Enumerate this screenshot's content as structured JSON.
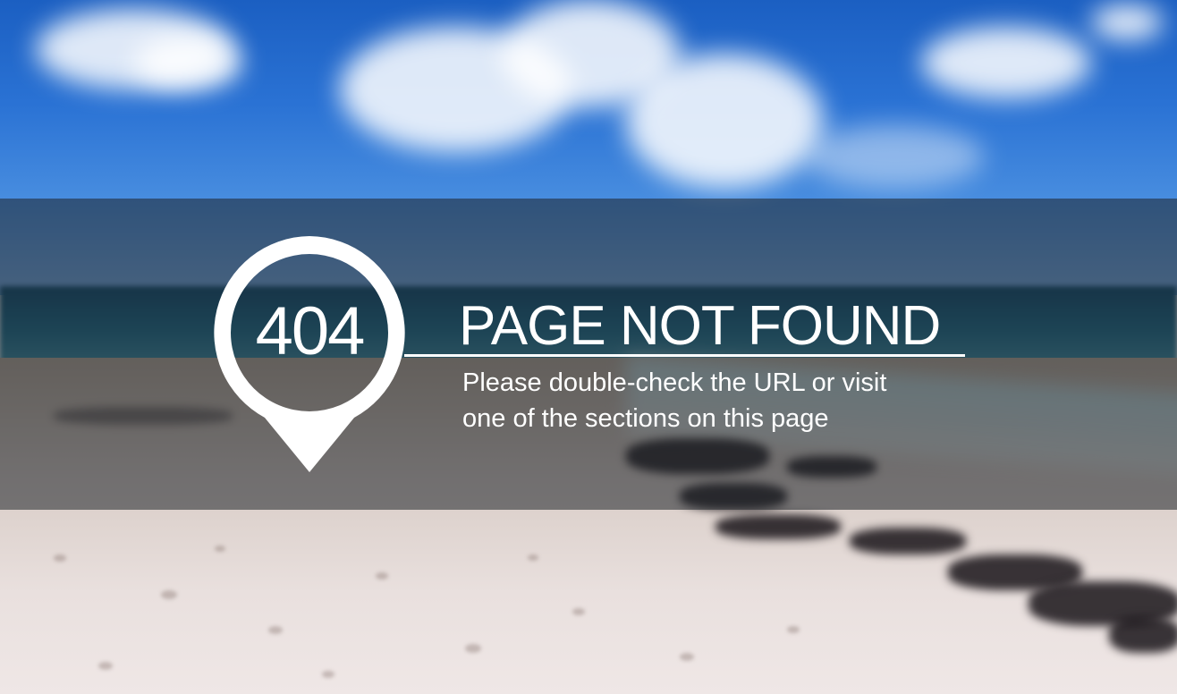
{
  "error": {
    "code": "404",
    "title": "PAGE NOT FOUND",
    "message_line1": "Please double-check the URL or visit",
    "message_line2": "one of the sections on this page"
  },
  "icons": {
    "pin": "map-pin-icon"
  },
  "colors": {
    "text": "#ffffff",
    "band": "rgba(30,34,40,0.55)",
    "sky": "#1b5fc2"
  }
}
